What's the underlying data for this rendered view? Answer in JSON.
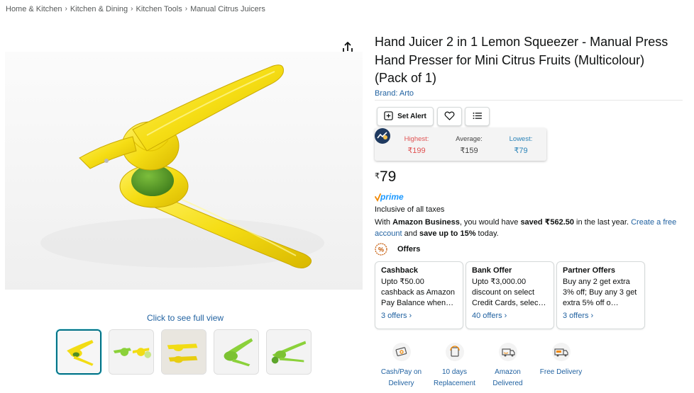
{
  "breadcrumb": [
    "Home & Kitchen",
    "Kitchen & Dining",
    "Kitchen Tools",
    "Manual Citrus Juicers"
  ],
  "breadcrumb_separator": "›",
  "product": {
    "title": "Hand Juicer 2 in 1 Lemon Squeezer - Manual Press Hand Presser for Mini Citrus Fruits (Multicolour) (Pack of 1)",
    "brand": "Brand: Arto",
    "full_view_link": "Click to see full view"
  },
  "actions": {
    "set_alert": "Set Alert"
  },
  "price_history": {
    "highest_label": "Highest:",
    "highest_value": "₹199",
    "average_label": "Average:",
    "average_value": "₹159",
    "lowest_label": "Lowest:",
    "lowest_value": "₹79"
  },
  "price": {
    "symbol": "₹",
    "amount": "79"
  },
  "prime_label": "prime",
  "inclusive": "Inclusive of all taxes",
  "business": {
    "prefix": "With ",
    "bold1": "Amazon Business",
    "mid": ", you would have ",
    "bold2": "saved ₹562.50",
    "mid2": " in the last year. ",
    "link": "Create a free account",
    "mid3": " and ",
    "bold3": "save up to 15%",
    "suffix": " today."
  },
  "offers": {
    "heading": "Offers",
    "cards": [
      {
        "title": "Cashback",
        "desc": "Upto ₹50.00 cashback as Amazon Pay Balance when…",
        "link": "3 offers ›"
      },
      {
        "title": "Bank Offer",
        "desc": "Upto ₹3,000.00 discount on select Credit Cards, selec…",
        "link": "40 offers ›"
      },
      {
        "title": "Partner Offers",
        "desc": "Buy any 2 get extra 3% off; Buy any 3 get extra 5% off o…",
        "link": "3 offers ›"
      }
    ]
  },
  "features": [
    {
      "label": "Cash/Pay on Delivery",
      "icon": "cash-on-delivery-icon"
    },
    {
      "label": "10 days Replacement",
      "icon": "replacement-icon"
    },
    {
      "label": "Amazon Delivered",
      "icon": "amazon-delivered-icon"
    },
    {
      "label": "Free Delivery",
      "icon": "free-delivery-icon"
    }
  ],
  "colors": {
    "link": "#2162a1",
    "highest": "#e05252",
    "lowest": "#2a83b8",
    "product_yellow": "#f2dc14",
    "product_green": "#8bd13a"
  }
}
